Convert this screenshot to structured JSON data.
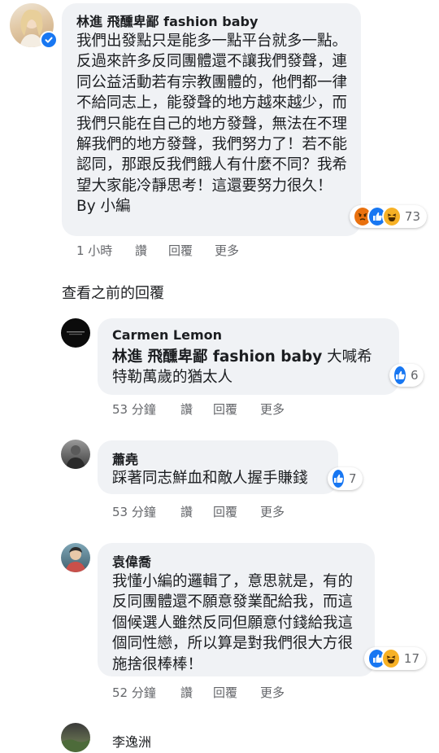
{
  "main_comment": {
    "author": "林進 飛醺卑鄙 fashion baby",
    "text": "我們出發點只是能多一點平台就多一點。反過來許多反同團體還不讓我們發聲，連同公益活動若有宗教團體的，他們都一律不給同志上，能發聲的地方越來越少，而我們只能在自己的地方發聲，無法在不理解我們的地方發聲，我們努力了！若不能認同，那跟反我們餓人有什麼不同？我希望大家能冷靜思考！這還要努力很久！By 小編",
    "time": "1 小時",
    "like_label": "讚",
    "reply_label": "回覆",
    "more_label": "更多",
    "reactions": [
      "angry-icon",
      "like-icon",
      "haha-icon"
    ],
    "reaction_count": "73"
  },
  "see_previous_label": "查看之前的回覆",
  "replies": [
    {
      "author": "Carmen Lemon",
      "mention": "林進 飛醺卑鄙 fashion baby",
      "text": " 大喊希特勒萬歲的猶太人",
      "time": "53 分鐘",
      "like_label": "讚",
      "reply_label": "回覆",
      "more_label": "更多",
      "reactions": [
        "like-icon"
      ],
      "reaction_count": "6"
    },
    {
      "author": "蕭堯",
      "text": "踩著同志鮮血和敵人握手賺錢",
      "time": "53 分鐘",
      "like_label": "讚",
      "reply_label": "回覆",
      "more_label": "更多",
      "reactions": [
        "like-icon"
      ],
      "reaction_count": "7"
    },
    {
      "author": "袁偉喬",
      "text": "我懂小編的邏輯了，意思就是，有的反同團體還不願意發業配給我，而這個候選人雖然反同但願意付錢給我這個同性戀，所以算是對我們很大方很施捨很棒棒！",
      "time": "52 分鐘",
      "like_label": "讚",
      "reply_label": "回覆",
      "more_label": "更多",
      "reactions": [
        "like-icon",
        "haha-icon"
      ],
      "reaction_count": "17"
    },
    {
      "author": "李逸洲"
    }
  ],
  "colors": {
    "bubble": "#f0f2f5",
    "meta": "#65676b",
    "like": "#1877f2",
    "haha": "#f7b125",
    "angry": "#e9710f"
  }
}
